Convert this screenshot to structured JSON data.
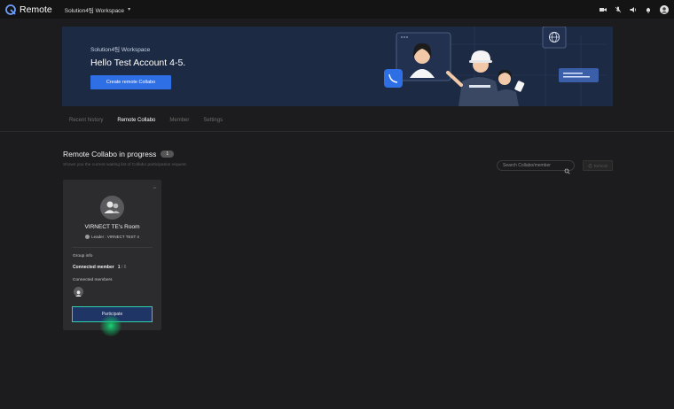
{
  "app": {
    "name": "Remote"
  },
  "workspace_selector": {
    "label": "Solution4팀 Workspace"
  },
  "hero": {
    "workspace": "Solution4팀 Workspace",
    "greeting": "Hello Test Account 4-5.",
    "create_button": "Create remote Collabo"
  },
  "tabs": [
    {
      "label": "Recent history",
      "active": false
    },
    {
      "label": "Remote Collabo",
      "active": true
    },
    {
      "label": "Member",
      "active": false
    },
    {
      "label": "Settings",
      "active": false
    }
  ],
  "section": {
    "title": "Remote Collabo in progress",
    "count": "1",
    "subtitle": "Shows you the current waiting list of Collabo participation request.",
    "search_placeholder": "Search Collabo/member",
    "refresh_label": "Refresh"
  },
  "card": {
    "more": "···",
    "room_name": "VIRNECT TE's Room",
    "leader": "Leader : VIRNECT TEST 4",
    "group_info_label": "Group info",
    "connected_member_label": "Connected member",
    "connected_count": "1",
    "connected_total": "/ 6",
    "connected_members_label": "Connected members",
    "participate_label": "Participate"
  },
  "colors": {
    "accent": "#2f6fe6",
    "focus": "#2fd1a9",
    "hero_bg": "#1c2a44",
    "card_bg": "#2c2c2e"
  }
}
